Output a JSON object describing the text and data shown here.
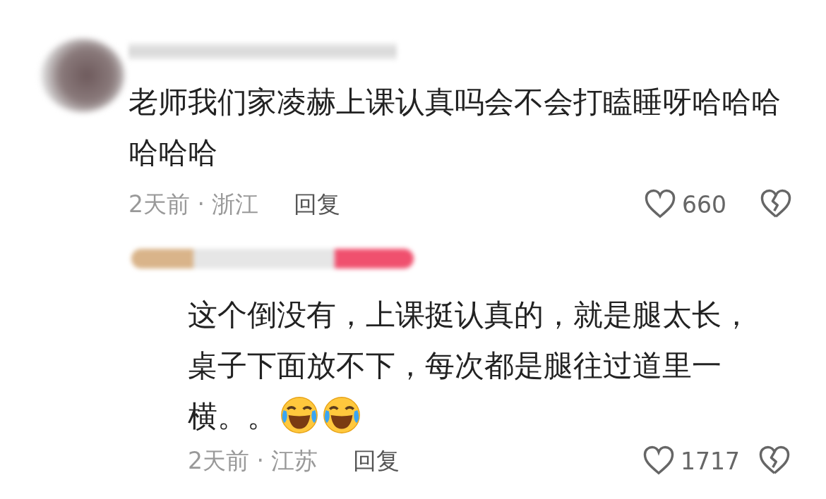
{
  "comment": {
    "text": "老师我们家凌赫上课认真吗会不会打瞌睡呀哈哈哈哈哈哈",
    "time_location": "2天前 · 浙江",
    "reply_label": "回复",
    "likes": "660"
  },
  "reply": {
    "text": "这个倒没有，上课挺认真的，就是腿太长，桌子下面放不下，每次都是腿往过道里一横。。",
    "emojis": [
      {
        "kind": "laughing-crying"
      },
      {
        "kind": "laughing-crying"
      }
    ],
    "time_location": "2天前 · 江苏",
    "reply_label": "回复",
    "likes": "1717"
  }
}
